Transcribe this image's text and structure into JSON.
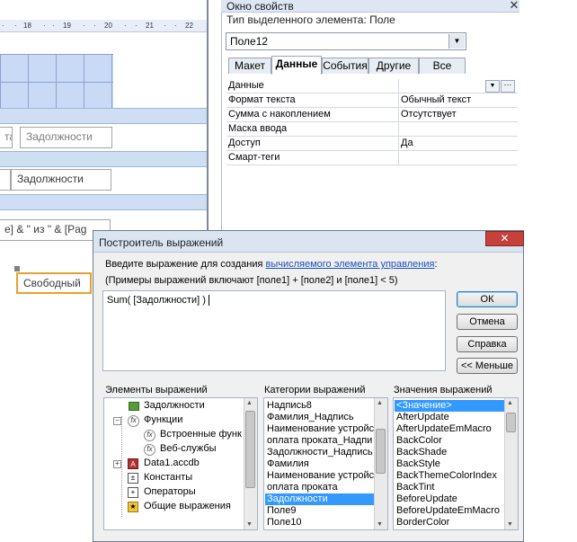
{
  "designer": {
    "ruler_marks": [
      "18",
      "19",
      "20",
      "21",
      "22"
    ],
    "field_partial": "та",
    "field_debt": "Задолжности",
    "field_debt2": "Задолжности",
    "page_expr": "е] & \" из \" & [Pag",
    "field_free": "Свободный"
  },
  "property_sheet": {
    "title": "Окно свойств",
    "selection_type": "Тип выделенного элемента:  Поле",
    "selected_object": "Поле12",
    "tabs": [
      "Макет",
      "Данные",
      "События",
      "Другие",
      "Все"
    ],
    "active_tab": "Данные",
    "rows": [
      {
        "name": "Данные",
        "value": ""
      },
      {
        "name": "Формат текста",
        "value": "Обычный текст"
      },
      {
        "name": "Сумма с накоплением",
        "value": "Отсутствует"
      },
      {
        "name": "Маска ввода",
        "value": ""
      },
      {
        "name": "Доступ",
        "value": "Да"
      },
      {
        "name": "Смарт-теги",
        "value": ""
      }
    ]
  },
  "dialog": {
    "title": "Построитель выражений",
    "instruction_prefix": "Введите выражение для создания ",
    "instruction_link": "вычисляемого элемента управления",
    "instruction_suffix": ":",
    "example": "(Примеры выражений включают [поле1] + [поле2] и [поле1] < 5)",
    "expression": "Sum( [Задолжности] )",
    "buttons": {
      "ok": "ОК",
      "cancel": "Отмена",
      "help": "Справка",
      "less": "<< Меньше"
    },
    "elements_header": "Элементы выражений",
    "categories_header": "Категории выражений",
    "values_header": "Значения выражений",
    "elements": [
      {
        "label": "Задолжности",
        "icon": "table-icon",
        "expander": ""
      },
      {
        "label": "Функции",
        "icon": "function-icon",
        "expander": "−"
      },
      {
        "label": "Встроенные функ",
        "icon": "function-icon",
        "expander": ""
      },
      {
        "label": "Веб-службы",
        "icon": "function-icon",
        "expander": ""
      },
      {
        "label": "Data1.accdb",
        "icon": "database-icon",
        "expander": "+"
      },
      {
        "label": "Константы",
        "icon": "constants-icon",
        "expander": ""
      },
      {
        "label": "Операторы",
        "icon": "operators-icon",
        "expander": ""
      },
      {
        "label": "Общие выражения",
        "icon": "common-expressions-icon",
        "expander": ""
      }
    ],
    "categories": [
      "Надпись8",
      "Фамилия_Надпись",
      "Наименование устройс",
      "оплата проката_Надпи",
      "Задолжности_Надпись",
      "Фамилия",
      "Наименование устройс",
      "оплата проката",
      "Задолжности",
      "Поле9",
      "Поле10"
    ],
    "selected_category": "Задолжности",
    "values": [
      "<Значение>",
      "AfterUpdate",
      "AfterUpdateEmMacro",
      "BackColor",
      "BackShade",
      "BackStyle",
      "BackThemeColorIndex",
      "BackTint",
      "BeforeUpdate",
      "BeforeUpdateEmMacro",
      "BorderColor"
    ],
    "selected_value": "<Значение>"
  }
}
